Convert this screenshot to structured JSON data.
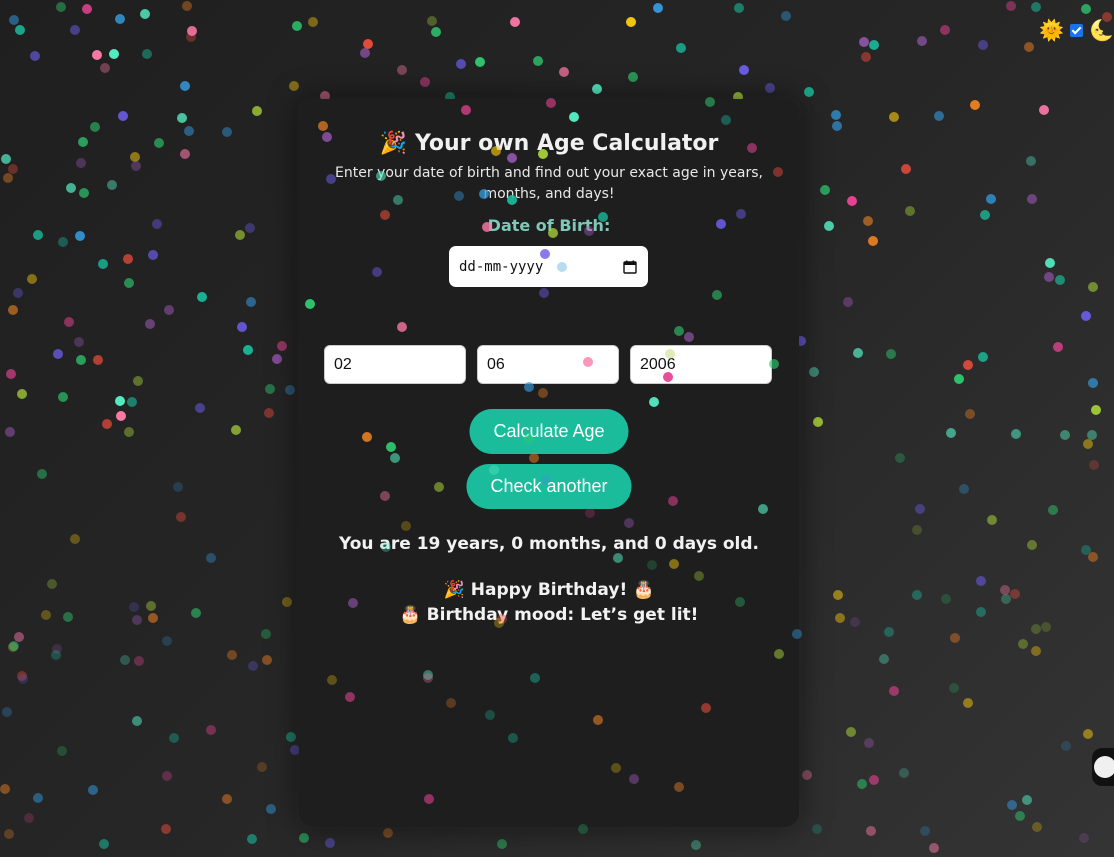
{
  "card": {
    "title_emoji": "🎉",
    "title": "Your own Age Calculator",
    "subtitle": "Enter your date of birth and find out your exact age in years, months, and days!",
    "dob_label": "Date of Birth:",
    "date_placeholder": "dd-mm-yyyy"
  },
  "inputs": {
    "day": "02",
    "month": "06",
    "year": "2006"
  },
  "buttons": {
    "calculate": "Calculate Age",
    "check_another": "Check another"
  },
  "result": {
    "age_text": "You are 19 years, 0 months, and 0 days old.",
    "birthday_line": "🎉 Happy Birthday! 🎂",
    "mood_line": "🎂 Birthday mood: Let’s get lit!"
  },
  "corner": {
    "sun_emoji": "🌞",
    "moon_emoji": "🌜"
  },
  "colors": {
    "accent": "#1abc9c",
    "label": "#7fc8b7",
    "card": "#1e1e1e"
  }
}
